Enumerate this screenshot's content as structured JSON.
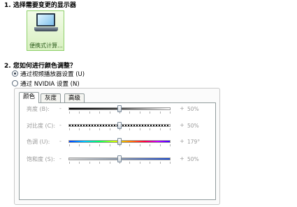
{
  "section1": {
    "heading": "1. 选择需要变更的显示器"
  },
  "display": {
    "label": "便携式计算..."
  },
  "section2": {
    "heading": "2. 您如何进行颜色调整？"
  },
  "options": [
    {
      "label": "通过视频播放器设置 (U)",
      "checked": true
    },
    {
      "label": "通过 NVIDIA 设置 (N)",
      "checked": false
    }
  ],
  "tabs": [
    {
      "label": "颜色",
      "active": true
    },
    {
      "label": "灰度",
      "active": false
    },
    {
      "label": "高级",
      "active": false
    }
  ],
  "sliders": [
    {
      "label": "亮度 (B):",
      "minus": "-",
      "plus": "+",
      "value_text": "50%",
      "level": 0.5,
      "track": "brightness"
    },
    {
      "label": "对比度 (C):",
      "minus": "-",
      "plus": "+",
      "value_text": "50%",
      "level": 0.5,
      "track": "contrast"
    },
    {
      "label": "色调 (U):",
      "minus": "-",
      "plus": "+",
      "value_text": "179°",
      "level": 0.5,
      "track": "hue"
    },
    {
      "label": "饱和度 (S):",
      "minus": "-",
      "plus": "+",
      "value_text": "50%",
      "level": 0.5,
      "track": "saturation"
    }
  ]
}
